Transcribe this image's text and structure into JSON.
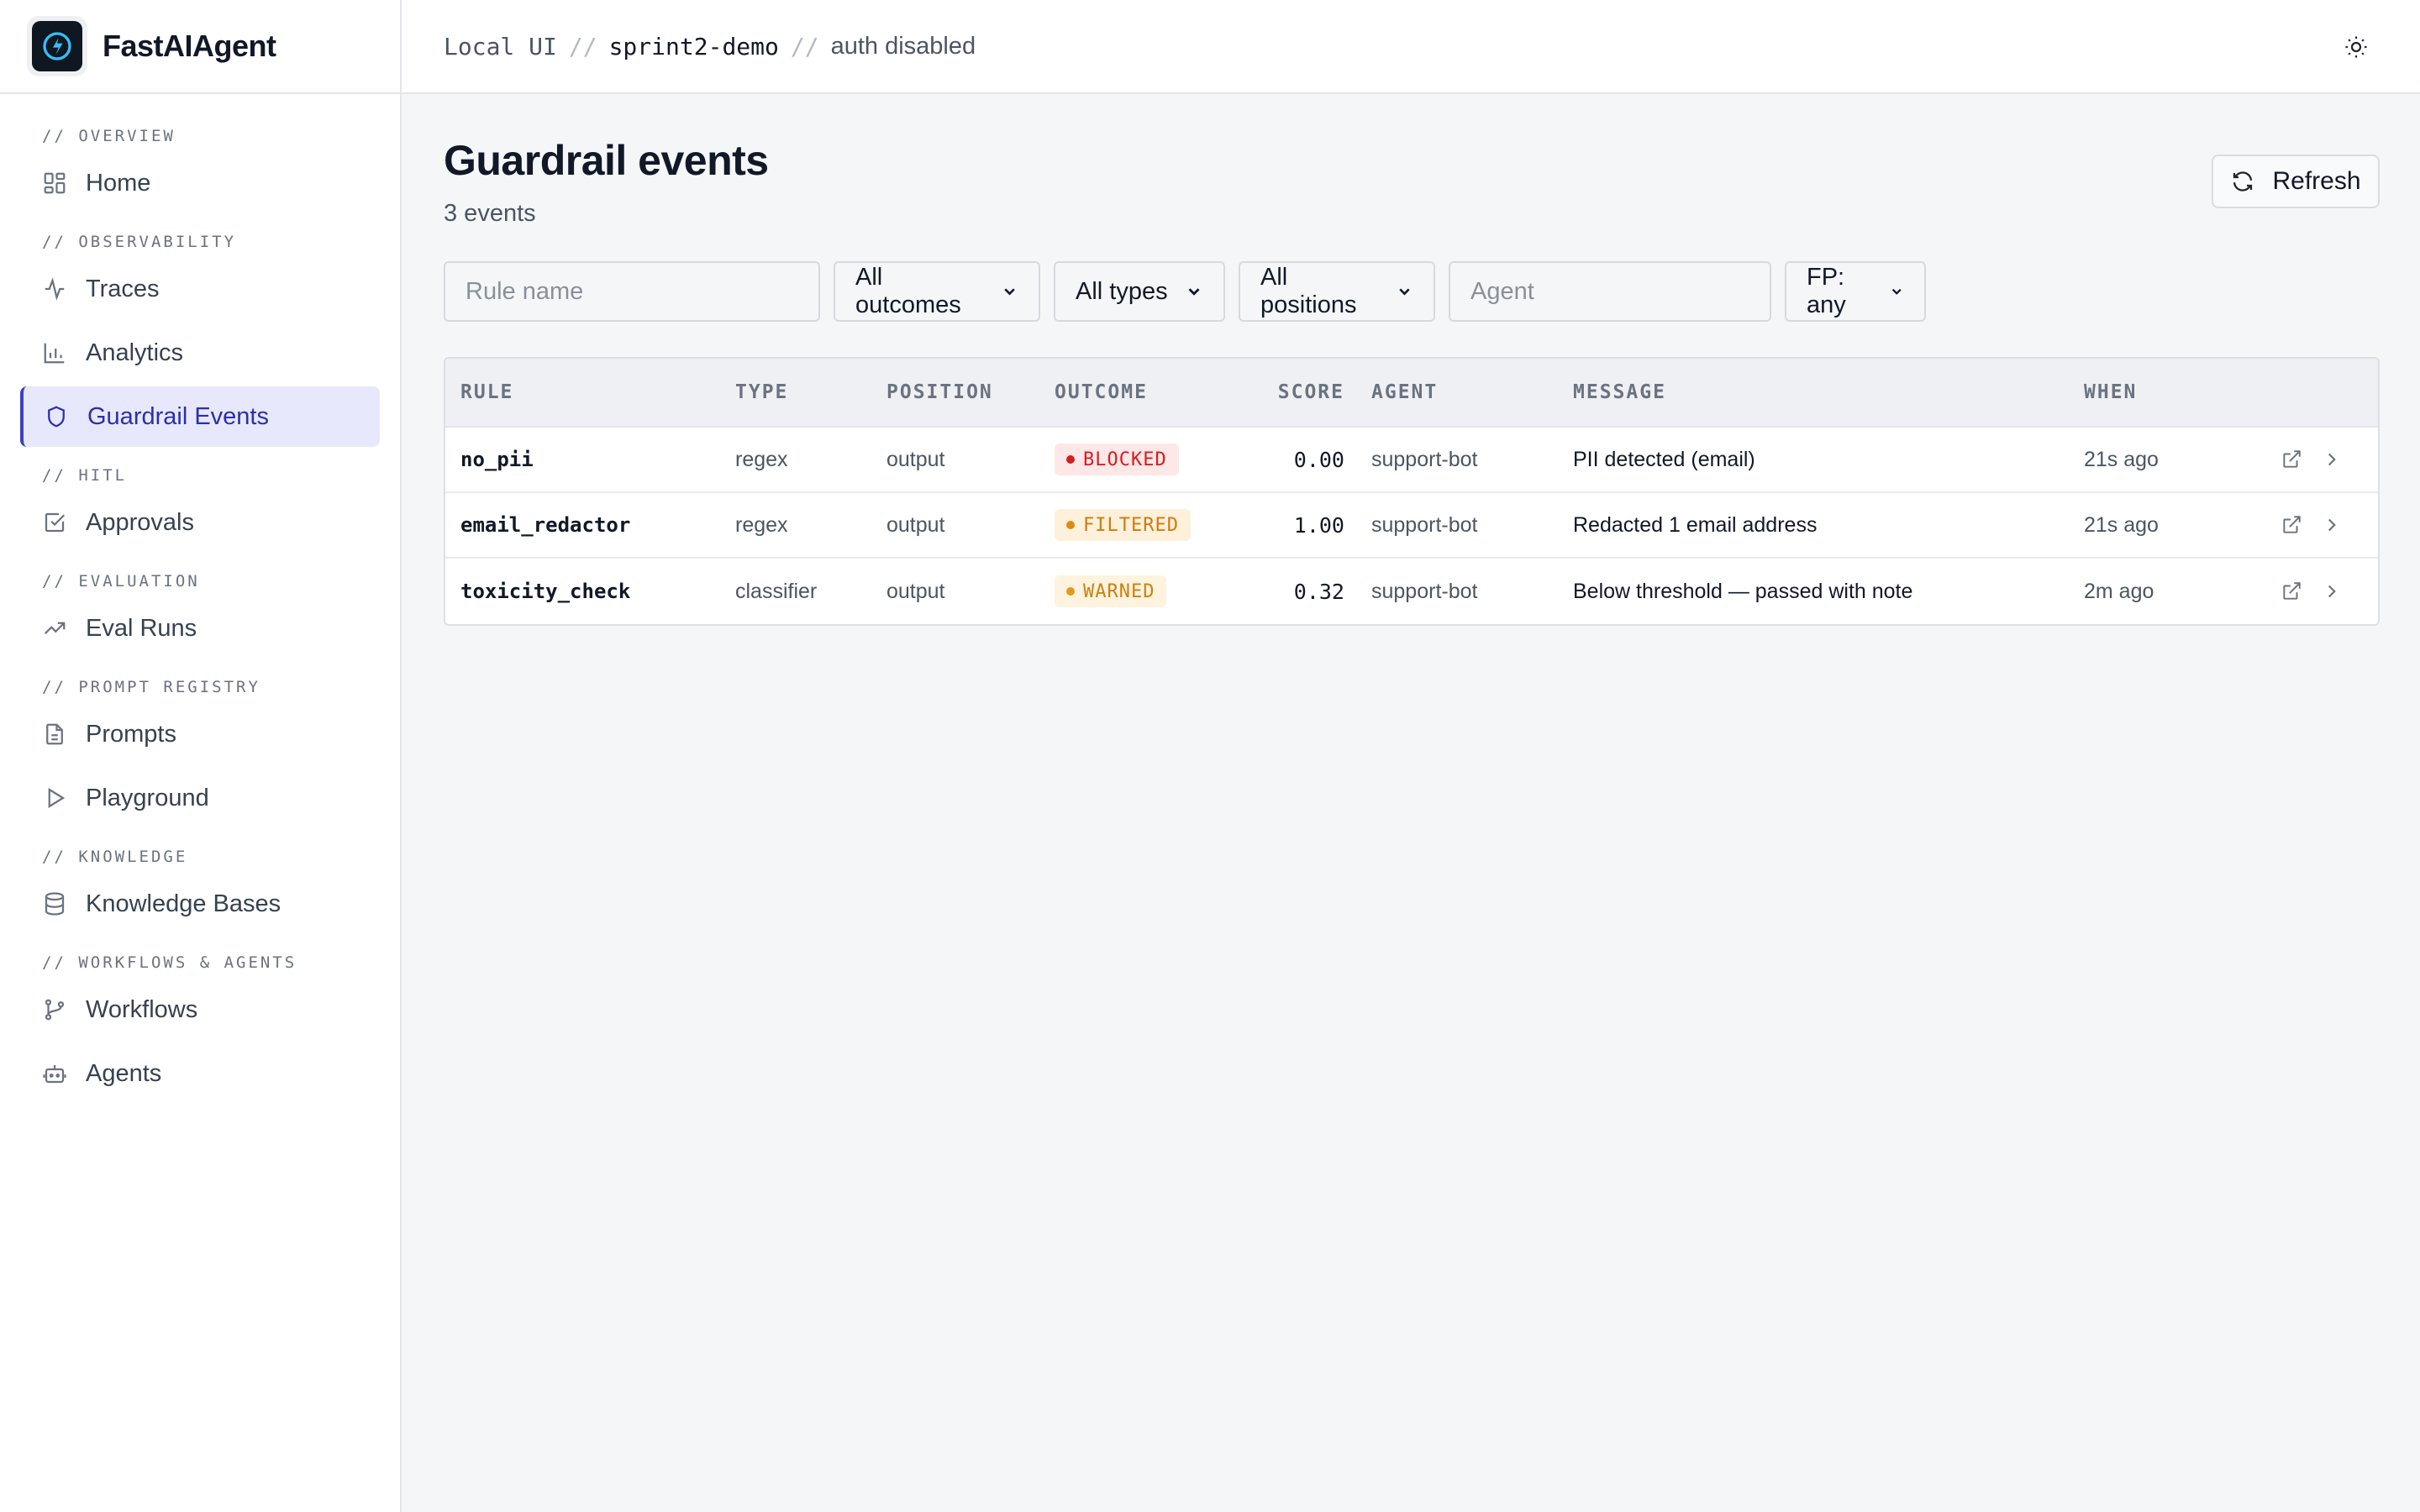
{
  "app": {
    "name": "FastAIAgent"
  },
  "breadcrumb": {
    "items": [
      "Local UI",
      "sprint2-demo",
      "auth disabled"
    ],
    "separator": "//"
  },
  "sidebar": {
    "sections": [
      {
        "label": "// OVERVIEW",
        "items": [
          {
            "label": "Home",
            "icon": "grid-icon"
          }
        ]
      },
      {
        "label": "// OBSERVABILITY",
        "items": [
          {
            "label": "Traces",
            "icon": "activity-icon"
          },
          {
            "label": "Analytics",
            "icon": "bar-chart-icon"
          },
          {
            "label": "Guardrail Events",
            "icon": "shield-icon",
            "active": true
          }
        ]
      },
      {
        "label": "// HITL",
        "items": [
          {
            "label": "Approvals",
            "icon": "check-square-icon"
          }
        ]
      },
      {
        "label": "// EVALUATION",
        "items": [
          {
            "label": "Eval Runs",
            "icon": "trending-up-icon"
          }
        ]
      },
      {
        "label": "// PROMPT REGISTRY",
        "items": [
          {
            "label": "Prompts",
            "icon": "file-text-icon"
          },
          {
            "label": "Playground",
            "icon": "play-icon"
          }
        ]
      },
      {
        "label": "// KNOWLEDGE",
        "items": [
          {
            "label": "Knowledge Bases",
            "icon": "database-icon"
          }
        ]
      },
      {
        "label": "// WORKFLOWS & AGENTS",
        "items": [
          {
            "label": "Workflows",
            "icon": "git-branch-icon"
          },
          {
            "label": "Agents",
            "icon": "bot-icon"
          }
        ]
      }
    ]
  },
  "page": {
    "title": "Guardrail events",
    "count": "3 events",
    "refresh_label": "Refresh"
  },
  "filters": {
    "rule_name_placeholder": "Rule name",
    "outcome": "All outcomes",
    "type": "All types",
    "position": "All positions",
    "agent_placeholder": "Agent",
    "fp": "FP: any"
  },
  "table": {
    "headers": {
      "rule": "RULE",
      "type": "TYPE",
      "position": "POSITION",
      "outcome": "OUTCOME",
      "score": "SCORE",
      "agent": "AGENT",
      "message": "MESSAGE",
      "when": "WHEN"
    },
    "rows": [
      {
        "rule": "no_pii",
        "type": "regex",
        "position": "output",
        "outcome": "BLOCKED",
        "outcome_kind": "blocked",
        "score": "0.00",
        "agent": "support-bot",
        "message": "PII detected (email)",
        "when": "21s ago"
      },
      {
        "rule": "email_redactor",
        "type": "regex",
        "position": "output",
        "outcome": "FILTERED",
        "outcome_kind": "filtered",
        "score": "1.00",
        "agent": "support-bot",
        "message": "Redacted 1 email address",
        "when": "21s ago"
      },
      {
        "rule": "toxicity_check",
        "type": "classifier",
        "position": "output",
        "outcome": "WARNED",
        "outcome_kind": "warned",
        "score": "0.32",
        "agent": "support-bot",
        "message": "Below threshold — passed with note",
        "when": "2m ago"
      }
    ]
  },
  "colors": {
    "accent": "#3b3fc8",
    "active_bg": "#e7e8fb",
    "blocked": "#d11f1f",
    "filtered": "#d27a08",
    "warned": "#c9820f"
  }
}
